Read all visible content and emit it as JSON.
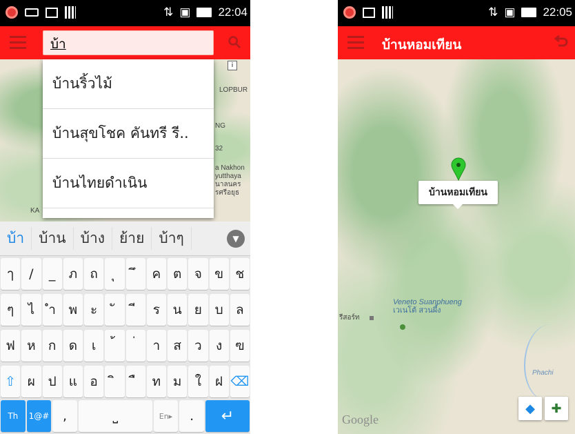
{
  "left": {
    "status": {
      "time": "22:04"
    },
    "search": {
      "value": "บ้า"
    },
    "dropdown": [
      "บ้านริ้วไม้",
      "บ้านสุขโชค คันทรี รี..",
      "บ้านไทยดำเนิน"
    ],
    "map_labels": [
      "LOPBUR",
      "NG",
      "32",
      "a Nakhon",
      "yutthaya",
      "นาลนคร",
      "รศรีอยุธ",
      "KA"
    ],
    "suggestions": [
      "บ้า",
      "บ้าน",
      "บ้าง",
      "ย้าย",
      "บ้าๆ"
    ],
    "keyboard": {
      "row1": [
        "ๅ",
        "/",
        "_",
        "ภ",
        "ถ",
        "ุ",
        "ึ",
        "ค",
        "ต",
        "จ",
        "ข",
        "ช"
      ],
      "row2": [
        "ๆ",
        "ไ",
        "ำ",
        "พ",
        "ะ",
        "ั",
        "ี",
        "ร",
        "น",
        "ย",
        "บ",
        "ล"
      ],
      "row3": [
        "ฟ",
        "ห",
        "ก",
        "ด",
        "เ",
        "้",
        "่",
        "า",
        "ส",
        "ว",
        "ง",
        "ฃ"
      ],
      "row4": [
        "ผ",
        "ป",
        "แ",
        "อ",
        "ิ",
        "ื",
        "ท",
        "ม",
        "ใ",
        "ฝ"
      ],
      "bottom": {
        "lang": "Th",
        "symbols": "1@#",
        "comma": ",",
        "en": "En▸",
        "period": "."
      }
    }
  },
  "right": {
    "status": {
      "time": "22:05"
    },
    "title": "บ้านหอมเทียน",
    "callout": "บ้านหอมเทียน",
    "place_en": "Veneto Suanphueng",
    "place_th": "เวเนโต้ สวนผึ้ง",
    "resort": "รีสอร์ท",
    "river": "Phachi",
    "attribution": "Google"
  },
  "colors": {
    "appbar": "#ff1a1a",
    "accent": "#2196f3",
    "marker": "#2ec82e"
  }
}
